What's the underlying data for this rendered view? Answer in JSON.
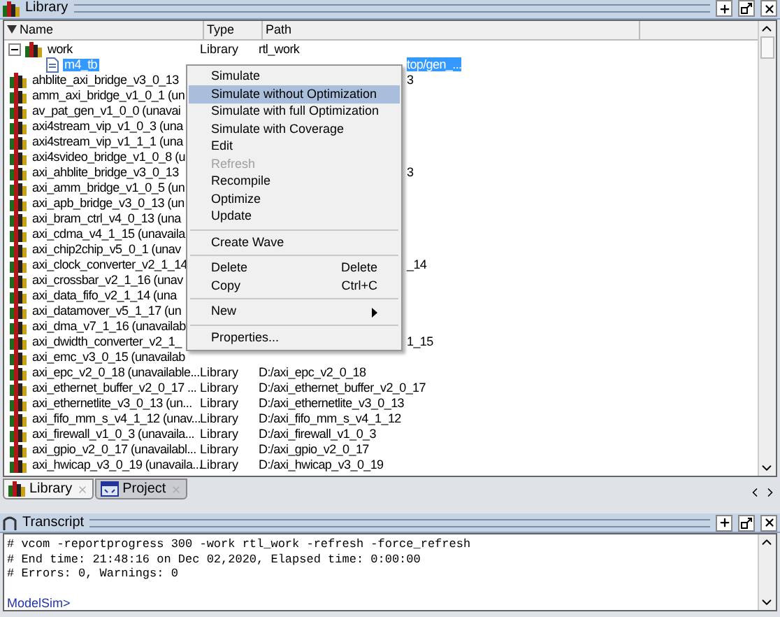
{
  "library_panel": {
    "title": "Library"
  },
  "columns": [
    "Name",
    "Type",
    "Path"
  ],
  "rows": [
    {
      "name": "work",
      "type": "Library",
      "path": "rtl_work",
      "kind": "library",
      "expanded": true,
      "selected": false,
      "children": [
        {
          "name": "m4_tb",
          "kind": "module",
          "selected": true,
          "path_tail": "top/gen_..."
        }
      ]
    },
    {
      "name": "ahblite_axi_bridge_v3_0_13",
      "kind": "library",
      "selected": false,
      "path_tail": "3"
    },
    {
      "name": "amm_axi_bridge_v1_0_1 (un",
      "kind": "library",
      "selected": false
    },
    {
      "name": "av_pat_gen_v1_0_0 (unavai",
      "kind": "library",
      "selected": false
    },
    {
      "name": "axi4stream_vip_v1_0_3 (una",
      "kind": "library",
      "selected": false
    },
    {
      "name": "axi4stream_vip_v1_1_1 (una",
      "kind": "library",
      "selected": false
    },
    {
      "name": "axi4svideo_bridge_v1_0_8 (u",
      "kind": "library",
      "selected": false
    },
    {
      "name": "axi_ahblite_bridge_v3_0_13",
      "kind": "library",
      "selected": false,
      "path_tail": "3"
    },
    {
      "name": "axi_amm_bridge_v1_0_5 (un",
      "kind": "library",
      "selected": false
    },
    {
      "name": "axi_apb_bridge_v3_0_13 (un",
      "kind": "library",
      "selected": false
    },
    {
      "name": "axi_bram_ctrl_v4_0_13 (una",
      "kind": "library",
      "selected": false
    },
    {
      "name": "axi_cdma_v4_1_15 (unavaila",
      "kind": "library",
      "selected": false
    },
    {
      "name": "axi_chip2chip_v5_0_1 (unav",
      "kind": "library",
      "selected": false
    },
    {
      "name": "axi_clock_converter_v2_1_14",
      "kind": "library",
      "selected": false,
      "path_tail": "_14"
    },
    {
      "name": "axi_crossbar_v2_1_16 (unav",
      "kind": "library",
      "selected": false
    },
    {
      "name": "axi_data_fifo_v2_1_14 (una",
      "kind": "library",
      "selected": false
    },
    {
      "name": "axi_datamover_v5_1_17 (un",
      "kind": "library",
      "selected": false
    },
    {
      "name": "axi_dma_v7_1_16 (unavailab",
      "kind": "library",
      "selected": false
    },
    {
      "name": "axi_dwidth_converter_v2_1_",
      "kind": "library",
      "selected": false,
      "path_tail": "1_15"
    },
    {
      "name": "axi_emc_v3_0_15 (unavailab",
      "kind": "library",
      "selected": false
    },
    {
      "name": "axi_epc_v2_0_18 (unavailable...",
      "type": "Library",
      "path": "D:/axi_epc_v2_0_18",
      "kind": "library",
      "selected": false
    },
    {
      "name": "axi_ethernet_buffer_v2_0_17 ...",
      "type": "Library",
      "path": "D:/axi_ethernet_buffer_v2_0_17",
      "kind": "library",
      "selected": false
    },
    {
      "name": "axi_ethernetlite_v3_0_13 (un...",
      "type": "Library",
      "path": "D:/axi_ethernetlite_v3_0_13",
      "kind": "library",
      "selected": false
    },
    {
      "name": "axi_fifo_mm_s_v4_1_12 (unav...",
      "type": "Library",
      "path": "D:/axi_fifo_mm_s_v4_1_12",
      "kind": "library",
      "selected": false
    },
    {
      "name": "axi_firewall_v1_0_3 (unavaila...",
      "type": "Library",
      "path": "D:/axi_firewall_v1_0_3",
      "kind": "library",
      "selected": false
    },
    {
      "name": "axi_gpio_v2_0_17 (unavailabl...",
      "type": "Library",
      "path": "D:/axi_gpio_v2_0_17",
      "kind": "library",
      "selected": false
    },
    {
      "name": "axi_hwicap_v3_0_19 (unavaila...",
      "type": "Library",
      "path": "D:/axi_hwicap_v3_0_19",
      "kind": "library",
      "selected": false
    }
  ],
  "context_menu": {
    "items": [
      {
        "kind": "item",
        "label": "Simulate",
        "selected": false,
        "disabled": false
      },
      {
        "kind": "item",
        "label": "Simulate without Optimization",
        "selected": true,
        "disabled": false
      },
      {
        "kind": "item",
        "label": "Simulate with full Optimization",
        "selected": false,
        "disabled": false
      },
      {
        "kind": "item",
        "label": "Simulate with Coverage",
        "selected": false,
        "disabled": false
      },
      {
        "kind": "item",
        "label": "Edit",
        "selected": false,
        "disabled": false
      },
      {
        "kind": "item",
        "label": "Refresh",
        "selected": false,
        "disabled": true
      },
      {
        "kind": "item",
        "label": "Recompile",
        "selected": false,
        "disabled": false
      },
      {
        "kind": "item",
        "label": "Optimize",
        "selected": false,
        "disabled": false
      },
      {
        "kind": "item",
        "label": "Update",
        "selected": false,
        "disabled": false
      },
      {
        "kind": "separator"
      },
      {
        "kind": "item",
        "label": "Create Wave",
        "selected": false,
        "disabled": false
      },
      {
        "kind": "separator"
      },
      {
        "kind": "item",
        "label": "Delete",
        "shortcut": "Delete",
        "selected": false,
        "disabled": false
      },
      {
        "kind": "item",
        "label": "Copy",
        "shortcut": "Ctrl+C",
        "selected": false,
        "disabled": false
      },
      {
        "kind": "separator"
      },
      {
        "kind": "submenu",
        "label": "New",
        "selected": false,
        "disabled": false
      },
      {
        "kind": "separator"
      },
      {
        "kind": "item",
        "label": "Properties...",
        "selected": false,
        "disabled": false
      }
    ]
  },
  "tabs": [
    {
      "label": "Library",
      "kind": "library",
      "selected": true
    },
    {
      "label": "Project",
      "kind": "project",
      "selected": false
    }
  ],
  "transcript": {
    "title": "Transcript",
    "lines": [
      "# vcom -reportprogress 300 -work rtl_work -refresh -force_refresh",
      "# End time: 21:48:16 on Dec 02,2020, Elapsed time: 0:00:00",
      "# Errors: 0, Warnings: 0"
    ],
    "prompt": "ModelSim>"
  }
}
